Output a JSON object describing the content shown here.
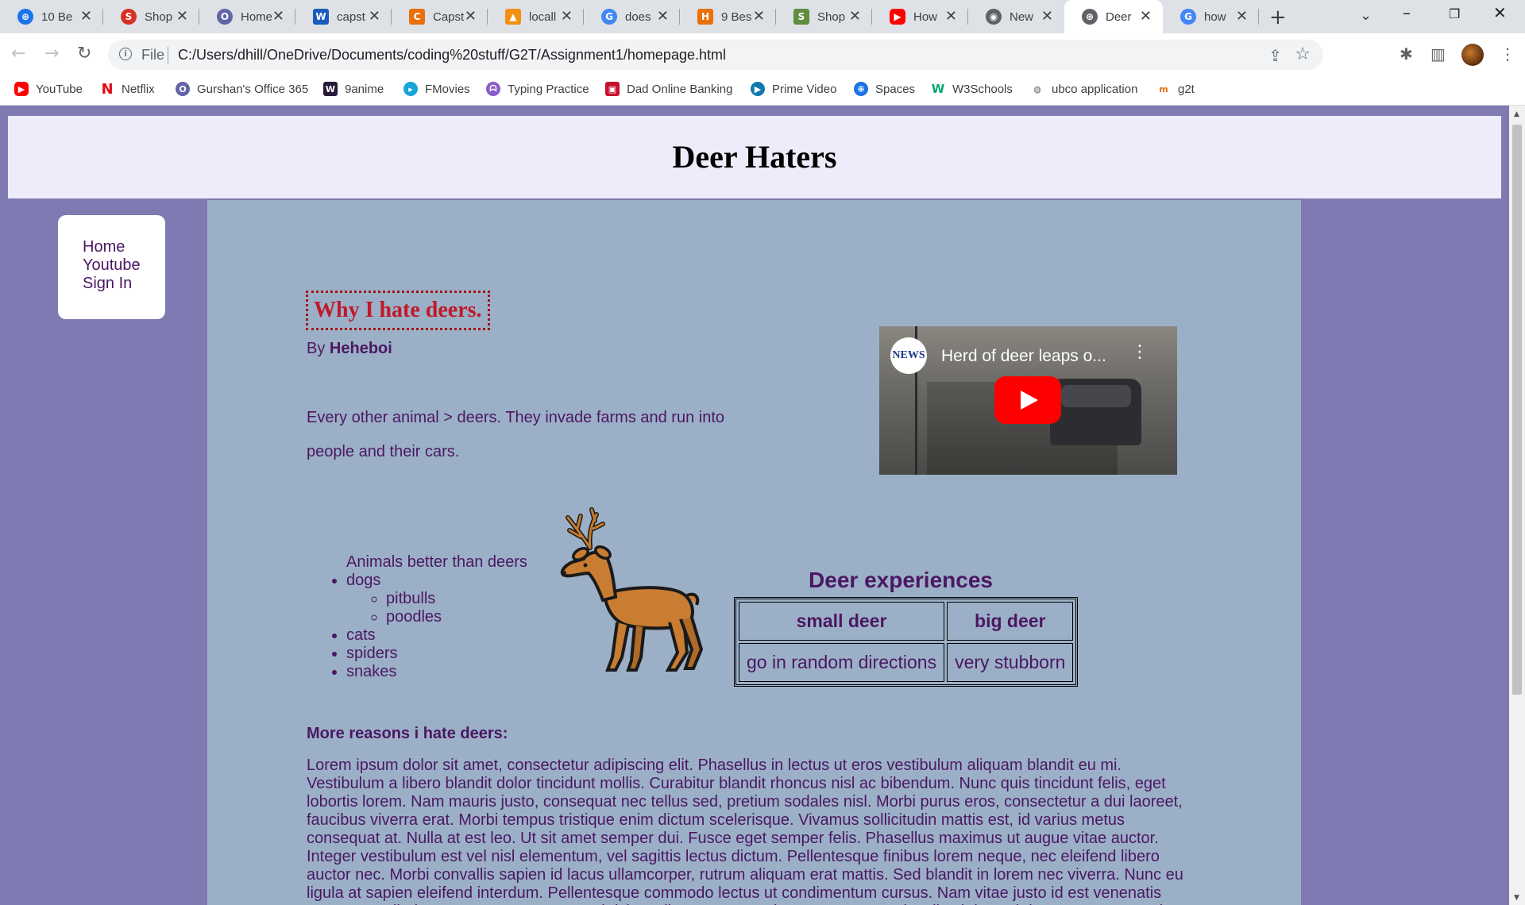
{
  "browser": {
    "tabs": [
      {
        "title": "10 Be",
        "icon": "globe-blue-icon",
        "color": "#1a73e8"
      },
      {
        "title": "Shop",
        "icon": "shopify-red-icon",
        "color": "#d93025"
      },
      {
        "title": "Home",
        "icon": "office-icon",
        "color": "#6264a7"
      },
      {
        "title": "capst",
        "icon": "word-icon",
        "color": "#185abd"
      },
      {
        "title": "Capst",
        "icon": "capstone-icon",
        "color": "#e8710a"
      },
      {
        "title": "locall",
        "icon": "phpmyadmin-icon",
        "color": "#f29111"
      },
      {
        "title": "does",
        "icon": "google-icon",
        "color": "#4285f4"
      },
      {
        "title": "9 Bes",
        "icon": "ha-icon",
        "color": "#e8710a"
      },
      {
        "title": "Shop",
        "icon": "shopify-green-icon",
        "color": "#5e8e3e"
      },
      {
        "title": "How",
        "icon": "youtube-icon",
        "color": "#ff0000"
      },
      {
        "title": "New",
        "icon": "chrome-icon",
        "color": "#5f6368"
      },
      {
        "title": "Deer",
        "icon": "globe-icon",
        "color": "#5f6368",
        "active": true
      },
      {
        "title": "how",
        "icon": "google-icon",
        "color": "#4285f4"
      }
    ],
    "new_tab_symbol": "+",
    "file_label": "File",
    "url": "C:/Users/dhill/OneDrive/Documents/coding%20stuff/G2T/Assignment1/homepage.html",
    "bookmarks": [
      {
        "label": "YouTube",
        "icon": "youtube-icon",
        "color": "#ff0000"
      },
      {
        "label": "Netflix",
        "icon": "netflix-icon",
        "color": "#e50914"
      },
      {
        "label": "Gurshan's Office 365",
        "icon": "office-icon",
        "color": "#6264a7"
      },
      {
        "label": "9anime",
        "icon": "9anime-icon",
        "color": "#2a1a3a"
      },
      {
        "label": "FMovies",
        "icon": "fmovies-icon",
        "color": "#19a5d6"
      },
      {
        "label": "Typing Practice",
        "icon": "typing-icon",
        "color": "#8a5cc7"
      },
      {
        "label": "Dad Online Banking",
        "icon": "bank-icon",
        "color": "#c8102e"
      },
      {
        "label": "Prime Video",
        "icon": "prime-video-icon",
        "color": "#1a98ff"
      },
      {
        "label": "Spaces",
        "icon": "spaces-icon",
        "color": "#1a73e8"
      },
      {
        "label": "W3Schools",
        "icon": "w3schools-icon",
        "color": "#04aa6d"
      },
      {
        "label": "ubco application",
        "icon": "ubco-icon",
        "color": "#5f6368"
      },
      {
        "label": "g2t",
        "icon": "g2t-icon",
        "color": "#e8710a"
      }
    ]
  },
  "page": {
    "site_title": "Deer Haters",
    "nav": [
      "Home",
      "Youtube",
      "Sign In"
    ],
    "article_title": "Why I hate deers.",
    "byline_prefix": "By",
    "author": "Heheboi",
    "intro": "Every other animal > deers. They invade farms and run into people and their cars.",
    "video": {
      "channel_logo": "NEWS",
      "title": "Herd of deer leaps o..."
    },
    "animals": {
      "caption": "Animals better than deers",
      "items": [
        "dogs",
        "cats",
        "spiders",
        "snakes"
      ],
      "dog_breeds": [
        "pitbulls",
        "poodles"
      ]
    },
    "table": {
      "caption": "Deer experiences",
      "headers": [
        "small deer",
        "big deer"
      ],
      "row": [
        "go in random directions",
        "very stubborn"
      ]
    },
    "more_title": "More reasons i hate deers:",
    "lorem": "Lorem ipsum dolor sit amet, consectetur adipiscing elit. Phasellus in lectus ut eros vestibulum aliquam blandit eu mi. Vestibulum a libero blandit dolor tincidunt mollis. Curabitur blandit rhoncus nisl ac bibendum. Nunc quis tincidunt felis, eget lobortis lorem. Nam mauris justo, consequat nec tellus sed, pretium sodales nisl. Morbi purus eros, consectetur a dui laoreet, faucibus viverra erat. Morbi tempus tristique enim dictum scelerisque. Vivamus sollicitudin mattis est, id varius metus consequat at. Nulla at est leo. Ut sit amet semper dui. Fusce eget semper felis. Phasellus maximus ut augue vitae auctor. Integer vestibulum est vel nisl elementum, vel sagittis lectus dictum. Pellentesque finibus lorem neque, nec eleifend libero auctor nec. Morbi convallis sapien id lacus ullamcorper, rutrum aliquam erat mattis. Sed blandit in lorem nec viverra. Nunc eu ligula at sapien eleifend interdum. Pellentesque commodo lectus ut condimentum cursus. Nam vitae justo id est venenatis cursus. Vestibulum et posuere sem, nec ultricies tellus. Praesent elementum, massa iaculis ultrices ultrices, urna ante varius"
  }
}
